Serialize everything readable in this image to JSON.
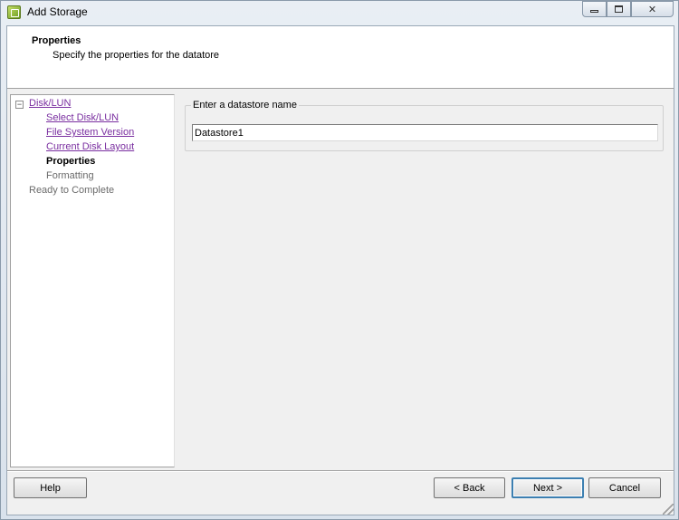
{
  "window": {
    "title": "Add Storage",
    "icon": "storage-wizard-icon",
    "controls": {
      "minimize": "minimize-icon",
      "maximize": "maximize-icon",
      "close_glyph": "✕"
    }
  },
  "header": {
    "title": "Properties",
    "subtitle": "Specify the properties for the datatore"
  },
  "steps": {
    "toggle_glyph": "−",
    "items": [
      {
        "label": "Disk/LUN",
        "state": "link"
      },
      {
        "label": "Select Disk/LUN",
        "state": "link"
      },
      {
        "label": "File System Version",
        "state": "link"
      },
      {
        "label": "Current Disk Layout",
        "state": "link"
      },
      {
        "label": "Properties",
        "state": "current"
      },
      {
        "label": "Formatting",
        "state": "future"
      },
      {
        "label": "Ready to Complete",
        "state": "future"
      }
    ]
  },
  "form": {
    "group_label": "Enter a datastore name",
    "datastore_name": "Datastore1"
  },
  "buttons": {
    "help": "Help",
    "back": "< Back",
    "next": "Next >",
    "cancel": "Cancel"
  },
  "colors": {
    "visited_link": "#7a2fa0",
    "default_button_border": "#3c7fb1"
  }
}
